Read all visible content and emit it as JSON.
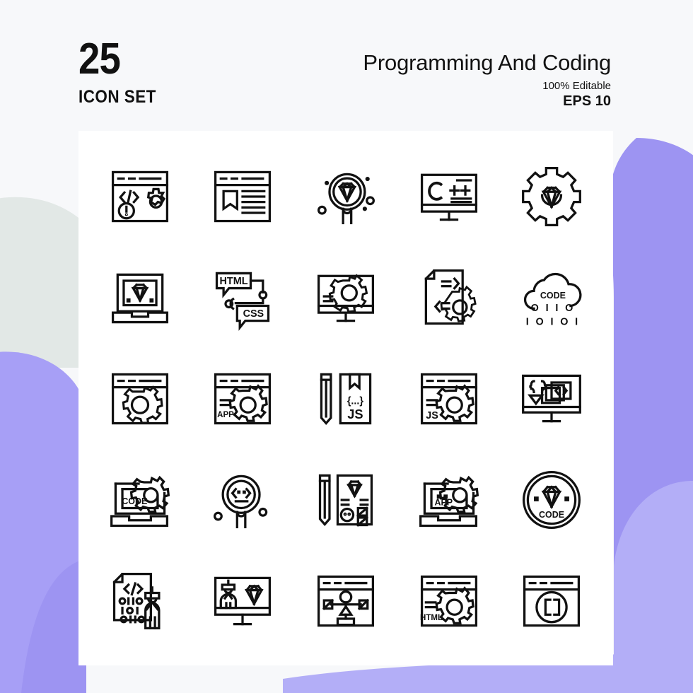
{
  "page": {
    "background_color": "#f7f8fa",
    "card_color": "#ffffff",
    "accent_purple": "#a39bf5",
    "accent_purple_light": "#b3aef7",
    "accent_gray": "#e2e8e6",
    "stroke_color": "#111111"
  },
  "header": {
    "count": "25",
    "count_label": "ICON SET",
    "title": "Programming And Coding",
    "editable_note": "100% Editable",
    "format": "EPS 10"
  },
  "grid": {
    "columns": 5,
    "rows": 5,
    "total": 25
  },
  "icons": [
    {
      "id": 1,
      "name": "browser-code-gear-alert",
      "labels": []
    },
    {
      "id": 2,
      "name": "browser-article-bookmark",
      "labels": []
    },
    {
      "id": 3,
      "name": "magnifier-diamond-search",
      "labels": []
    },
    {
      "id": 4,
      "name": "monitor-cplusplus",
      "labels": [
        "C",
        "+",
        "+"
      ]
    },
    {
      "id": 5,
      "name": "gear-diamond",
      "labels": []
    },
    {
      "id": 6,
      "name": "laptop-diamond",
      "labels": []
    },
    {
      "id": 7,
      "name": "html-css-chat-bubbles",
      "labels": [
        "HTML",
        "CSS"
      ]
    },
    {
      "id": 8,
      "name": "monitor-gear-code",
      "labels": []
    },
    {
      "id": 9,
      "name": "file-code-gear",
      "labels": []
    },
    {
      "id": 10,
      "name": "cloud-code-binary",
      "labels": [
        "CODE",
        "O I I O",
        "I O I O I"
      ]
    },
    {
      "id": 11,
      "name": "browser-gear",
      "labels": []
    },
    {
      "id": 12,
      "name": "browser-app-gear",
      "labels": [
        "APP"
      ]
    },
    {
      "id": 13,
      "name": "pencil-js-bookmark-file",
      "labels": [
        "{...}",
        "JS"
      ]
    },
    {
      "id": 14,
      "name": "browser-js-gear",
      "labels": [
        "JS"
      ]
    },
    {
      "id": 15,
      "name": "monitor-code-layers",
      "labels": []
    },
    {
      "id": 16,
      "name": "laptop-code-gear",
      "labels": [
        "CODE"
      ]
    },
    {
      "id": 17,
      "name": "magnifier-code-face",
      "labels": []
    },
    {
      "id": 18,
      "name": "pencil-design-diamond-file",
      "labels": []
    },
    {
      "id": 19,
      "name": "laptop-app-gear",
      "labels": [
        "APP"
      ]
    },
    {
      "id": 20,
      "name": "badge-diamond-code",
      "labels": [
        "CODE"
      ]
    },
    {
      "id": 21,
      "name": "file-binary-developer",
      "labels": []
    },
    {
      "id": 22,
      "name": "monitor-developer-diamond",
      "labels": []
    },
    {
      "id": 23,
      "name": "browser-sitemap-nodes",
      "labels": []
    },
    {
      "id": 24,
      "name": "browser-html-gear",
      "labels": [
        "HTML"
      ]
    },
    {
      "id": 25,
      "name": "browser-brackets",
      "labels": []
    }
  ]
}
